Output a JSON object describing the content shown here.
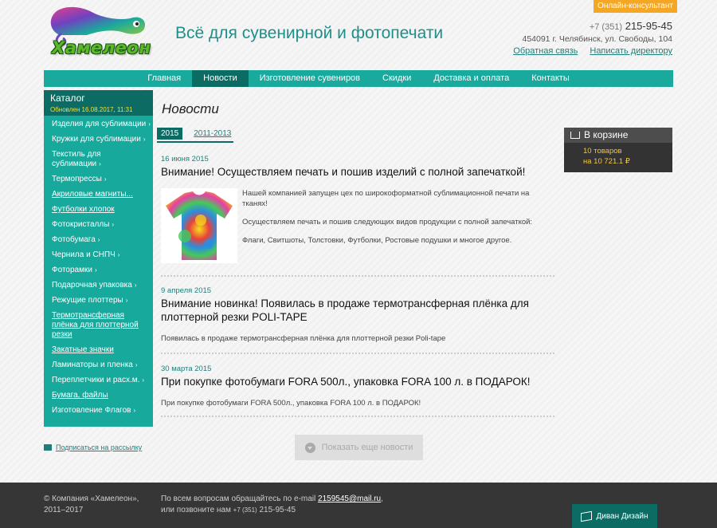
{
  "header": {
    "logo_text": "Хамелеон",
    "tagline": "Всё для сувенирной и фотопечати",
    "online_consultant": "Онлайн-консультант",
    "phone_code": "+7 (351)",
    "phone_number": "215-95-45",
    "address": "454091 г. Челябинск, ул. Свободы, 104",
    "links": [
      "Обратная связь",
      "Написать директору"
    ]
  },
  "nav": {
    "items": [
      "Главная",
      "Новости",
      "Изготовление сувениров",
      "Скидки",
      "Доставка и оплата",
      "Контакты"
    ],
    "active_index": 1
  },
  "sidebar": {
    "title": "Каталог",
    "updated": "Обновлен 16.08.2017, 11:31",
    "items": [
      "Изделия для сублимации",
      "Кружки для сублимации",
      "Текстиль для сублимации",
      "Термопрессы",
      "Акриловые магниты...",
      "Футболки хлопок",
      "Фотокристаллы",
      "Фотобумага",
      "Чернила и СНПЧ",
      "Фоторамки",
      "Подарочная упаковка",
      "Режущие плоттеры",
      "Термотрансферная плёнка для плоттерной резки",
      "Закатные значки",
      "Ламинаторы и пленка",
      "Переплетчики и расх.м.",
      "Бумага, файлы",
      "Изготовление Флагов"
    ],
    "subscribe": "Подписаться на рассылку"
  },
  "content": {
    "page_title": "Новости",
    "years": [
      "2015",
      "2011-2013"
    ],
    "news": [
      {
        "date": "16 июня 2015",
        "title": "Внимание! Осуществляем печать и пошив изделий с полной запечаткой!",
        "p1": "Нашей компанией запущен цех по широкоформатной сублимационной печати на тканях!",
        "p2": "Осуществляем печать и пошив следующих видов продукции с полной запечаткой:",
        "p3": "Флаги, Свитшоты, Толстовки, Футболки, Ростовые подушки и многое другое."
      },
      {
        "date": "9 апреля 2015",
        "title": "Внимание новинка! Появилась в продаже термотрансферная плёнка для плоттерной резки POLI-TAPE",
        "p1": "Появилась в продаже термотрансферная плёнка для плоттерной резки Poli-tape"
      },
      {
        "date": "30 марта 2015",
        "title": "При покупке фотобумаги FORA 500л., упаковка FORA 100 л. в ПОДАРОК!",
        "p1": "При покупке фотобумаги FORA 500л., упаковка FORA 100 л. в ПОДАРОК!"
      }
    ],
    "more_button": "Показать еще новости"
  },
  "cart": {
    "title": "В корзине",
    "count": "10 товаров",
    "total": "на 10 721.1 ₽"
  },
  "footer": {
    "copyright": "© Компания «Хамелеон», 2011–2017",
    "contact_prefix": "По всем вопросам обращайтесь по e-mail",
    "email": "2159545@mail.ru",
    "contact_phone_prefix": "или позвоните нам",
    "phone_code": "+7 (351)",
    "phone": "215-95-45",
    "designer": "Диван Дизайн"
  },
  "colors": {
    "teal": "#1aa99d",
    "dark_teal": "#0c6c64",
    "orange": "#f5a623",
    "cart_yellow": "#f3c63f"
  }
}
